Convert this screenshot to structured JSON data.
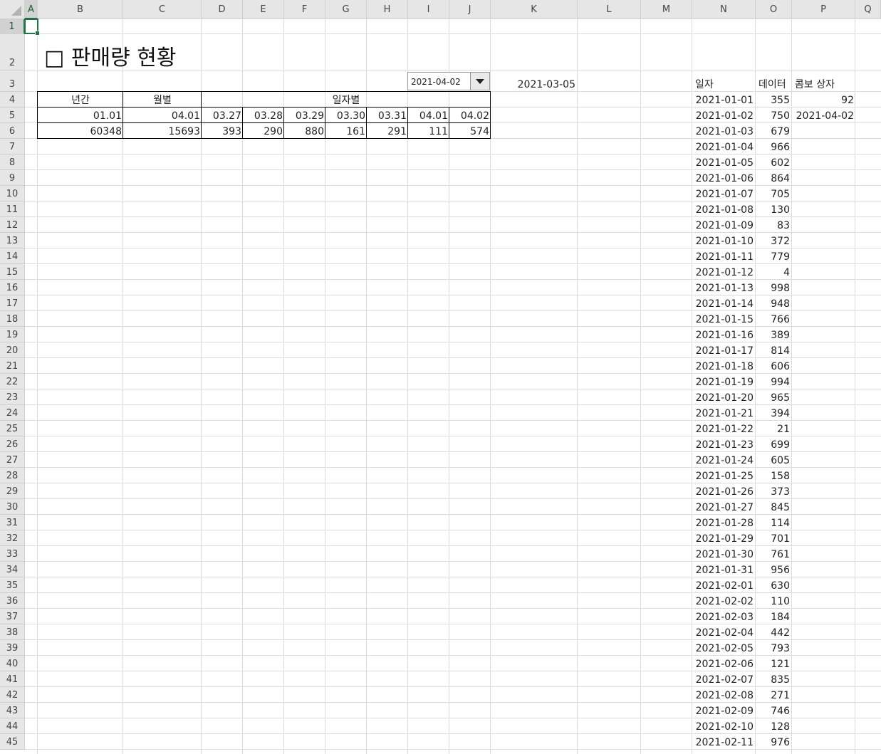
{
  "columns": [
    "A",
    "B",
    "C",
    "D",
    "E",
    "F",
    "G",
    "H",
    "I",
    "J",
    "K",
    "L",
    "M",
    "N",
    "O",
    "P",
    "Q"
  ],
  "title": "□ 판매량 현황",
  "summary_table": {
    "header_annual": "년간",
    "header_monthly": "월별",
    "header_daily": "일자별",
    "date_row": [
      "01.01",
      "04.01",
      "03.27",
      "03.28",
      "03.29",
      "03.30",
      "03.31",
      "04.01",
      "04.02"
    ],
    "value_row": [
      "60348",
      "15693",
      "393",
      "290",
      "880",
      "161",
      "291",
      "111",
      "574"
    ]
  },
  "combo": {
    "value": "2021-04-02"
  },
  "k3_value": "2021-03-05",
  "side_headers": {
    "date": "일자",
    "data": "데이터",
    "combo": "콤보 상자"
  },
  "combo_index": "92",
  "combo_link_value": "2021-04-02",
  "side_data": [
    [
      "2021-01-01",
      "355"
    ],
    [
      "2021-01-02",
      "750"
    ],
    [
      "2021-01-03",
      "679"
    ],
    [
      "2021-01-04",
      "966"
    ],
    [
      "2021-01-05",
      "602"
    ],
    [
      "2021-01-06",
      "864"
    ],
    [
      "2021-01-07",
      "705"
    ],
    [
      "2021-01-08",
      "130"
    ],
    [
      "2021-01-09",
      "83"
    ],
    [
      "2021-01-10",
      "372"
    ],
    [
      "2021-01-11",
      "779"
    ],
    [
      "2021-01-12",
      "4"
    ],
    [
      "2021-01-13",
      "998"
    ],
    [
      "2021-01-14",
      "948"
    ],
    [
      "2021-01-15",
      "766"
    ],
    [
      "2021-01-16",
      "389"
    ],
    [
      "2021-01-17",
      "814"
    ],
    [
      "2021-01-18",
      "606"
    ],
    [
      "2021-01-19",
      "994"
    ],
    [
      "2021-01-20",
      "965"
    ],
    [
      "2021-01-21",
      "394"
    ],
    [
      "2021-01-22",
      "21"
    ],
    [
      "2021-01-23",
      "699"
    ],
    [
      "2021-01-24",
      "605"
    ],
    [
      "2021-01-25",
      "158"
    ],
    [
      "2021-01-26",
      "373"
    ],
    [
      "2021-01-27",
      "845"
    ],
    [
      "2021-01-28",
      "114"
    ],
    [
      "2021-01-29",
      "701"
    ],
    [
      "2021-01-30",
      "761"
    ],
    [
      "2021-01-31",
      "956"
    ],
    [
      "2021-02-01",
      "630"
    ],
    [
      "2021-02-02",
      "110"
    ],
    [
      "2021-02-03",
      "184"
    ],
    [
      "2021-02-04",
      "442"
    ],
    [
      "2021-02-05",
      "793"
    ],
    [
      "2021-02-06",
      "121"
    ],
    [
      "2021-02-07",
      "835"
    ],
    [
      "2021-02-08",
      "271"
    ],
    [
      "2021-02-09",
      "746"
    ],
    [
      "2021-02-10",
      "128"
    ],
    [
      "2021-02-11",
      "976"
    ]
  ]
}
